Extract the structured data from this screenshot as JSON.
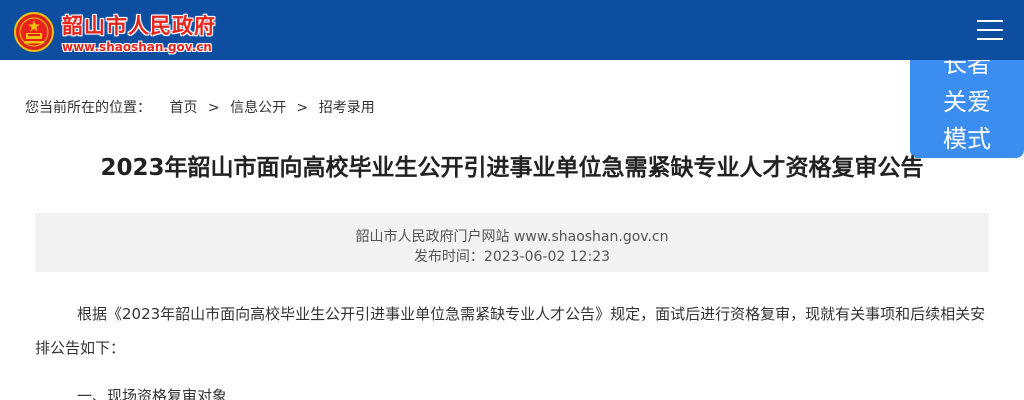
{
  "header": {
    "site_name": "韶山市人民政府",
    "site_url": "www.shaoshan.gov.cn",
    "brand_color": "#0d4ea1",
    "logo_text_color": "#e8231b"
  },
  "elder_mode": {
    "lines": [
      "长者",
      "关爱",
      "模式"
    ],
    "color": "#3b8ef0"
  },
  "breadcrumb": {
    "prefix": "您当前所在的位置：",
    "items": [
      "首页",
      "信息公开",
      "招考录用"
    ],
    "separator": ">"
  },
  "article": {
    "title": "2023年韶山市面向高校毕业生公开引进事业单位急需紧缺专业人才资格复审公告",
    "source": "韶山市人民政府门户网站 www.shaoshan.gov.cn",
    "publish_label": "发布时间：",
    "publish_time": "2023-06-02 12:23",
    "paragraph1": "根据《2023年韶山市面向高校毕业生公开引进事业单位急需紧缺专业人才公告》规定，面试后进行资格复审，现就有关事项和后续相关安排公告如下：",
    "section1": "一、现场资格复审对象"
  }
}
